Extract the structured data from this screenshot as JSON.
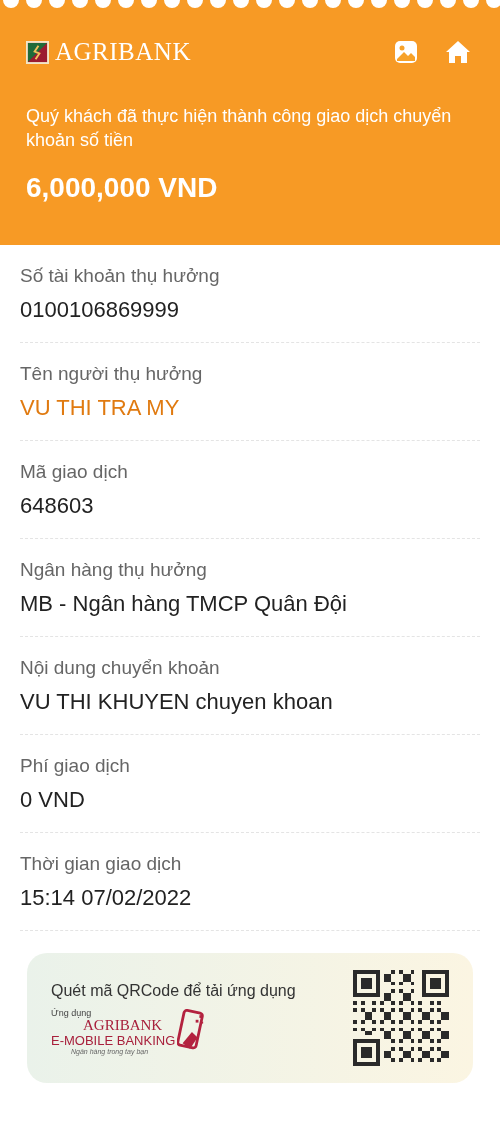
{
  "header": {
    "brand": "AGRIBANK",
    "message": "Quý khách đã thực hiện thành công giao dịch chuyển khoản số tiền",
    "amount": "6,000,000 VND"
  },
  "fields": [
    {
      "label": "Số tài khoản thụ hưởng",
      "value": "0100106869999",
      "kind": "plain"
    },
    {
      "label": "Tên người thụ hưởng",
      "value": "VU THI TRA MY",
      "kind": "accent"
    },
    {
      "label": "Mã giao dịch",
      "value": "648603",
      "kind": "plain"
    },
    {
      "label": "Ngân hàng thụ hưởng",
      "value": "MB - Ngân hàng TMCP Quân Đội",
      "kind": "plain"
    },
    {
      "label": "Nội dung chuyển khoản",
      "value": "VU THI KHUYEN chuyen khoan",
      "kind": "plain"
    },
    {
      "label": "Phí giao dịch",
      "value": "0 VND",
      "kind": "plain"
    },
    {
      "label": "Thời gian giao dịch",
      "value": "15:14 07/02/2022",
      "kind": "plain"
    }
  ],
  "promo": {
    "title": "Quét mã QRCode để tải ứng dụng",
    "app_label": "Ứng dụng",
    "app_brand": "AGRIBANK",
    "app_name": "E-MOBILE BANKING",
    "tagline": "Ngân hàng trong tay bạn"
  }
}
